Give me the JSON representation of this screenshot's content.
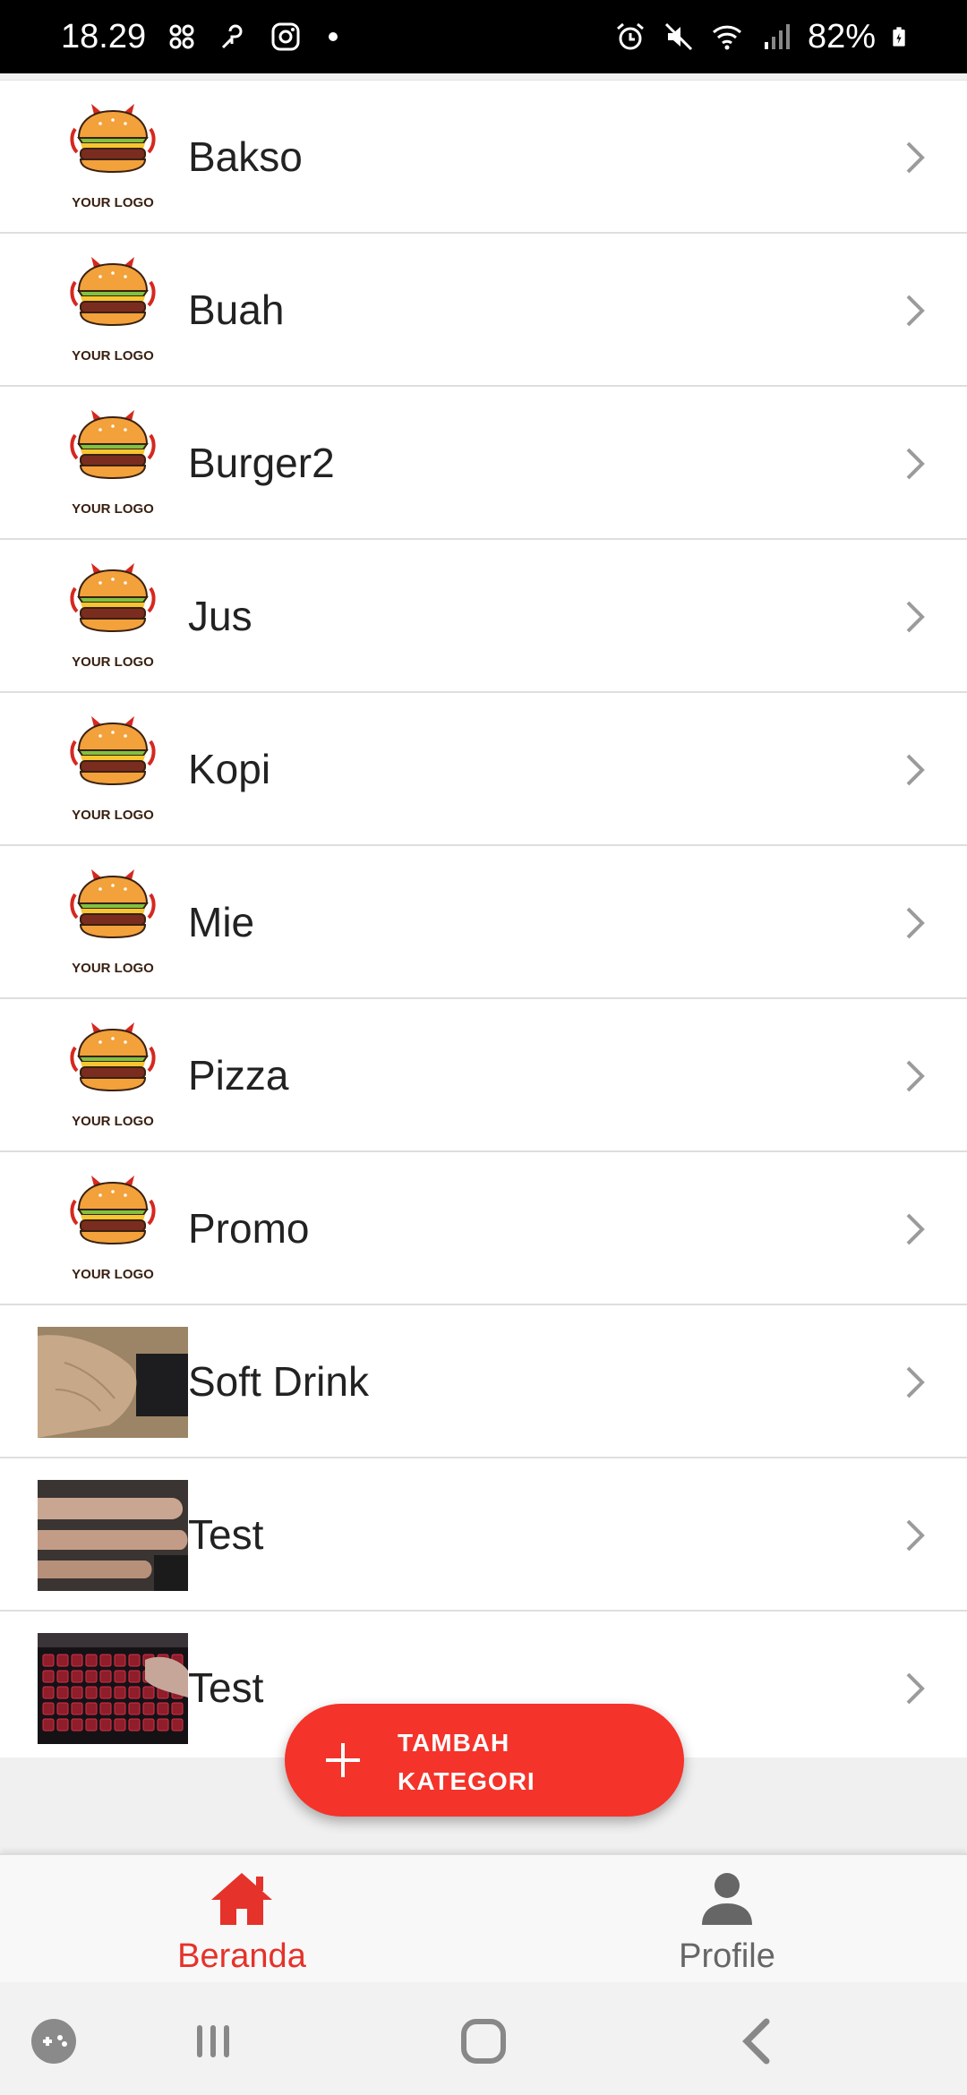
{
  "status_bar": {
    "time": "18.29",
    "battery": "82%"
  },
  "categories": [
    {
      "name": "Bakso",
      "thumb": "burger-logo",
      "logo_text": "YOUR LOGO"
    },
    {
      "name": "Buah",
      "thumb": "burger-logo",
      "logo_text": "YOUR LOGO"
    },
    {
      "name": "Burger2",
      "thumb": "burger-logo",
      "logo_text": "YOUR LOGO"
    },
    {
      "name": "Jus",
      "thumb": "burger-logo",
      "logo_text": "YOUR LOGO"
    },
    {
      "name": "Kopi",
      "thumb": "burger-logo",
      "logo_text": "YOUR LOGO"
    },
    {
      "name": "Mie",
      "thumb": "burger-logo",
      "logo_text": "YOUR LOGO"
    },
    {
      "name": "Pizza",
      "thumb": "burger-logo",
      "logo_text": "YOUR LOGO"
    },
    {
      "name": "Promo",
      "thumb": "burger-logo",
      "logo_text": "YOUR LOGO"
    },
    {
      "name": "Soft Drink",
      "thumb": "photo-hand-on-keyboard"
    },
    {
      "name": "Test",
      "thumb": "photo-fingers"
    },
    {
      "name": "Test",
      "thumb": "photo-red-keyboard"
    }
  ],
  "fab": {
    "label_line1": "TAMBAH",
    "label_line2": "KATEGORI",
    "icon": "plus-icon",
    "color": "#f4332a"
  },
  "bottom_nav": {
    "items": [
      {
        "label": "Beranda",
        "icon": "home-icon",
        "active": true
      },
      {
        "label": "Profile",
        "icon": "person-icon",
        "active": false
      }
    ],
    "active_color": "#e5322a",
    "inactive_color": "#666666"
  },
  "system_nav": {
    "buttons": [
      "game-launcher-icon",
      "recent-apps-icon",
      "home-button-icon",
      "back-icon"
    ]
  }
}
